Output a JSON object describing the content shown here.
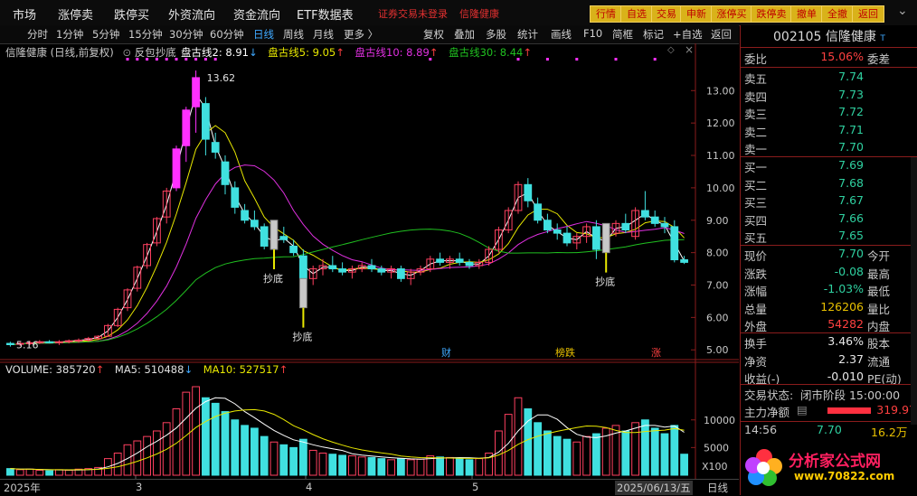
{
  "topbar": {
    "menus": [
      "市场",
      "涨停卖",
      "跌停买",
      "外资流向",
      "资金流向",
      "ETF数据表"
    ],
    "notice": [
      "证券交易未登录",
      "信隆健康"
    ],
    "buttons": [
      "行情",
      "自选",
      "交易",
      "申新",
      "涨停买",
      "跌停卖",
      "撤单",
      "全撤",
      "返回"
    ]
  },
  "toolbar": {
    "periods": [
      "分时",
      "1分钟",
      "5分钟",
      "15分钟",
      "30分钟",
      "60分钟",
      "日线",
      "周线",
      "月线",
      "更多 〉"
    ],
    "active_period": "日线",
    "tools": [
      "复权",
      "叠加",
      "多股",
      "统计",
      "画线",
      "F10",
      "简框",
      "标记",
      "+自选",
      "返回"
    ]
  },
  "chart_header": {
    "title": "信隆健康 (日线,前复权)",
    "indicator": "反包抄底",
    "lines": [
      {
        "label": "盘古线2: 8.91",
        "arrow": "↓",
        "color": "#ffffff"
      },
      {
        "label": "盘古线5: 9.05",
        "arrow": "↑",
        "color": "#e8e800"
      },
      {
        "label": "盘古线10: 8.89",
        "arrow": "↑",
        "color": "#e030e0"
      },
      {
        "label": "盘古线30: 8.44",
        "arrow": "↑",
        "color": "#20c020"
      }
    ]
  },
  "volume_header": {
    "items": [
      {
        "label": "VOLUME: 385720",
        "arrow": "↑",
        "color": "#e0e0e0"
      },
      {
        "label": "MA5: 510488",
        "arrow": "↓",
        "color": "#e0e0e0"
      },
      {
        "label": "MA10: 527517",
        "arrow": "↑",
        "color": "#e8e800"
      }
    ]
  },
  "annotations": {
    "high": "13.62",
    "low": "5.16",
    "buy_label": "抄底",
    "events": [
      "财",
      "榜跌",
      "涨"
    ]
  },
  "bottom_axis": {
    "labels": [
      "2025年",
      "3",
      "4",
      "5",
      "2025/06/13/五"
    ],
    "period": "日线"
  },
  "panel": {
    "code": "002105",
    "name": "信隆健康",
    "weibi_label": "委比",
    "weibi_value": "15.06%",
    "weicha_label": "委差",
    "asks": [
      {
        "label": "卖五",
        "price": "7.74"
      },
      {
        "label": "卖四",
        "price": "7.73"
      },
      {
        "label": "卖三",
        "price": "7.72"
      },
      {
        "label": "卖二",
        "price": "7.71"
      },
      {
        "label": "卖一",
        "price": "7.70"
      }
    ],
    "bids": [
      {
        "label": "买一",
        "price": "7.69"
      },
      {
        "label": "买二",
        "price": "7.68"
      },
      {
        "label": "买三",
        "price": "7.67"
      },
      {
        "label": "买四",
        "price": "7.66"
      },
      {
        "label": "买五",
        "price": "7.65"
      }
    ],
    "stats": [
      {
        "label": "现价",
        "value": "7.70",
        "right": "今开",
        "color": "#2fd0a0"
      },
      {
        "label": "涨跌",
        "value": "-0.08",
        "right": "最高",
        "color": "#2fd0a0"
      },
      {
        "label": "涨幅",
        "value": "-1.03%",
        "right": "最低",
        "color": "#2fd0a0"
      },
      {
        "label": "总量",
        "value": "126206",
        "right": "量比",
        "color": "#e8c000"
      },
      {
        "label": "外盘",
        "value": "54282",
        "right": "内盘",
        "color": "#ff4040"
      }
    ],
    "stats2": [
      {
        "label": "换手",
        "value": "3.46%",
        "right": "股本"
      },
      {
        "label": "净资",
        "value": "2.37",
        "right": "流通"
      },
      {
        "label": "收益(-)",
        "value": "-0.010",
        "right": "PE(动)"
      }
    ],
    "status_label": "交易状态:",
    "status_value": "闭市阶段 15:00:00",
    "flow_label": "主力净额",
    "flow_value": "319.97",
    "tick_time": "14:56",
    "tick_price": "7.70",
    "tick_vol": "16.2万",
    "watermark_name": "分析家公式网",
    "watermark_url": "www.70822.com"
  },
  "chart_data": {
    "type": "candlestick",
    "price_axis": [
      5.0,
      6.0,
      7.0,
      8.0,
      9.0,
      10.0,
      11.0,
      12.0,
      13.0
    ],
    "volume_axis_labels": [
      "10000",
      "5000",
      "X100"
    ],
    "candles": [
      [
        5.2,
        5.25,
        5.1,
        5.16
      ],
      [
        5.18,
        5.25,
        5.12,
        5.2
      ],
      [
        5.2,
        5.28,
        5.15,
        5.22
      ],
      [
        5.22,
        5.3,
        5.18,
        5.25
      ],
      [
        5.25,
        5.3,
        5.2,
        5.22
      ],
      [
        5.22,
        5.3,
        5.15,
        5.25
      ],
      [
        5.25,
        5.32,
        5.2,
        5.28
      ],
      [
        5.28,
        5.35,
        5.22,
        5.3
      ],
      [
        5.3,
        5.4,
        5.25,
        5.35
      ],
      [
        5.35,
        5.45,
        5.3,
        5.42
      ],
      [
        5.42,
        5.8,
        5.4,
        5.75
      ],
      [
        5.75,
        6.3,
        5.7,
        6.25
      ],
      [
        6.3,
        6.9,
        6.2,
        6.85
      ],
      [
        6.9,
        7.6,
        6.8,
        7.55
      ],
      [
        7.6,
        8.3,
        7.5,
        8.25
      ],
      [
        8.3,
        9.1,
        8.2,
        9.05
      ],
      [
        9.1,
        10.0,
        8.9,
        9.9
      ],
      [
        10.0,
        11.3,
        9.9,
        11.2
      ],
      [
        11.3,
        12.5,
        10.8,
        12.4
      ],
      [
        12.5,
        13.62,
        11.7,
        13.4
      ],
      [
        12.6,
        12.8,
        11.0,
        11.5
      ],
      [
        11.4,
        11.7,
        10.9,
        11.1
      ],
      [
        10.8,
        11.0,
        9.8,
        10.1
      ],
      [
        10.0,
        10.2,
        9.2,
        9.4
      ],
      [
        9.3,
        9.5,
        8.9,
        9.0
      ],
      [
        9.0,
        9.3,
        8.7,
        8.8
      ],
      [
        8.8,
        8.9,
        8.1,
        8.2
      ],
      [
        8.3,
        8.6,
        8.1,
        8.5
      ],
      [
        8.5,
        8.8,
        8.3,
        8.4
      ],
      [
        8.2,
        8.4,
        7.9,
        8.0
      ],
      [
        7.9,
        8.1,
        6.3,
        7.2
      ],
      [
        7.2,
        7.6,
        7.0,
        7.5
      ],
      [
        7.5,
        7.8,
        7.3,
        7.6
      ],
      [
        7.6,
        7.9,
        7.4,
        7.5
      ],
      [
        7.5,
        7.7,
        7.3,
        7.4
      ],
      [
        7.4,
        7.6,
        7.2,
        7.5
      ],
      [
        7.5,
        7.7,
        7.4,
        7.6
      ],
      [
        7.6,
        7.8,
        7.4,
        7.5
      ],
      [
        7.5,
        7.6,
        7.3,
        7.4
      ],
      [
        7.4,
        7.6,
        7.2,
        7.5
      ],
      [
        7.5,
        7.6,
        7.1,
        7.2
      ],
      [
        7.2,
        7.5,
        7.0,
        7.4
      ],
      [
        7.4,
        7.6,
        7.3,
        7.5
      ],
      [
        7.5,
        7.9,
        7.4,
        7.8
      ],
      [
        7.8,
        8.0,
        7.6,
        7.7
      ],
      [
        7.7,
        7.9,
        7.5,
        7.8
      ],
      [
        7.8,
        8.0,
        7.6,
        7.7
      ],
      [
        7.7,
        7.8,
        7.5,
        7.6
      ],
      [
        7.6,
        7.8,
        7.5,
        7.7
      ],
      [
        7.7,
        8.2,
        7.6,
        8.1
      ],
      [
        8.1,
        8.8,
        8.0,
        8.7
      ],
      [
        8.7,
        9.4,
        8.6,
        9.3
      ],
      [
        9.3,
        10.2,
        9.2,
        10.1
      ],
      [
        10.1,
        10.3,
        9.4,
        9.6
      ],
      [
        9.5,
        9.7,
        8.9,
        9.0
      ],
      [
        9.0,
        9.2,
        8.6,
        8.7
      ],
      [
        8.7,
        8.9,
        8.4,
        8.6
      ],
      [
        8.6,
        8.8,
        8.2,
        8.3
      ],
      [
        8.3,
        8.6,
        8.1,
        8.5
      ],
      [
        8.5,
        8.9,
        8.3,
        8.8
      ],
      [
        8.8,
        9.0,
        7.8,
        8.1
      ],
      [
        8.1,
        8.7,
        8.0,
        8.6
      ],
      [
        8.6,
        9.0,
        8.5,
        8.9
      ],
      [
        8.9,
        9.2,
        8.6,
        8.7
      ],
      [
        8.5,
        9.4,
        8.4,
        9.3
      ],
      [
        9.3,
        9.9,
        9.0,
        9.1
      ],
      [
        9.1,
        9.3,
        8.8,
        8.9
      ],
      [
        8.9,
        9.1,
        8.6,
        8.8
      ],
      [
        8.8,
        9.0,
        7.7,
        7.78
      ],
      [
        7.78,
        7.9,
        7.65,
        7.7
      ]
    ],
    "volumes": [
      12,
      10,
      11,
      9,
      8,
      10,
      9,
      11,
      12,
      14,
      30,
      40,
      55,
      62,
      70,
      80,
      95,
      120,
      150,
      160,
      140,
      130,
      115,
      100,
      90,
      85,
      70,
      60,
      55,
      50,
      65,
      45,
      40,
      38,
      36,
      35,
      33,
      32,
      30,
      28,
      30,
      28,
      29,
      35,
      33,
      32,
      30,
      28,
      30,
      40,
      80,
      110,
      140,
      120,
      95,
      80,
      70,
      65,
      60,
      70,
      75,
      85,
      90,
      80,
      95,
      100,
      85,
      75,
      90,
      38
    ],
    "ma2": [],
    "note": ""
  }
}
